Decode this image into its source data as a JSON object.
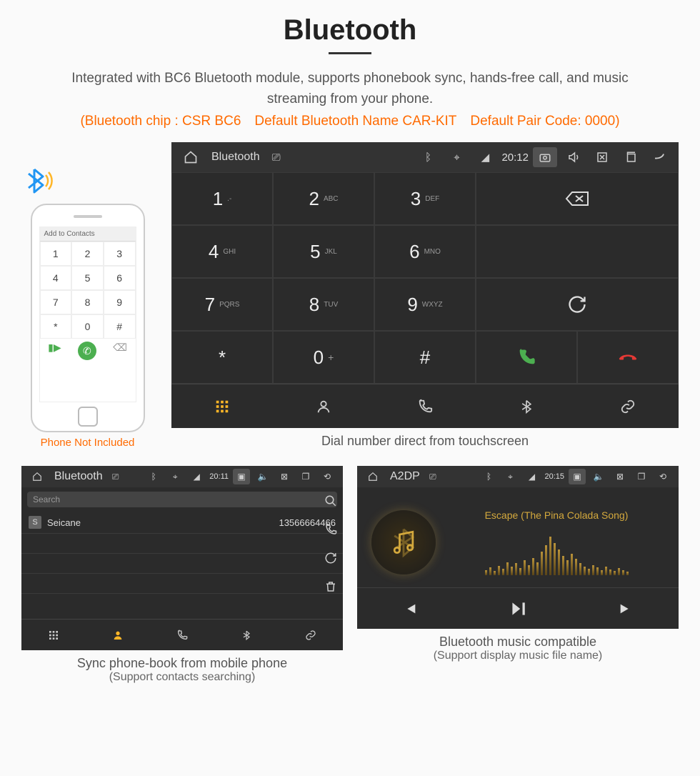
{
  "header": {
    "title": "Bluetooth",
    "description": "Integrated with BC6 Bluetooth module, supports phonebook sync, hands-free call, and music streaming from your phone.",
    "spec": "(Bluetooth chip : CSR BC6 Default Bluetooth Name CAR-KIT Default Pair Code: 0000)"
  },
  "phone": {
    "header": "Add to Contacts",
    "keys": [
      "1",
      "2",
      "3",
      "4",
      "5",
      "6",
      "7",
      "8",
      "9",
      "*",
      "0",
      "#"
    ],
    "caption": "Phone Not Included"
  },
  "dialer": {
    "statusbar": {
      "app": "Bluetooth",
      "time": "20:12"
    },
    "keys": [
      {
        "n": "1",
        "s": ".-"
      },
      {
        "n": "2",
        "s": "ABC"
      },
      {
        "n": "3",
        "s": "DEF"
      },
      {
        "n": "4",
        "s": "GHI"
      },
      {
        "n": "5",
        "s": "JKL"
      },
      {
        "n": "6",
        "s": "MNO"
      },
      {
        "n": "7",
        "s": "PQRS"
      },
      {
        "n": "8",
        "s": "TUV"
      },
      {
        "n": "9",
        "s": "WXYZ"
      },
      {
        "n": "*",
        "s": ""
      },
      {
        "n": "0",
        "s": "+"
      },
      {
        "n": "#",
        "s": ""
      }
    ],
    "caption": "Dial number direct from touchscreen"
  },
  "phonebook": {
    "statusbar": {
      "app": "Bluetooth",
      "time": "20:11"
    },
    "search_placeholder": "Search",
    "contact": {
      "badge": "S",
      "name": "Seicane",
      "number": "13566664466"
    },
    "caption_line1": "Sync phone-book from mobile phone",
    "caption_line2": "(Support contacts searching)"
  },
  "music": {
    "statusbar": {
      "app": "A2DP",
      "time": "20:15"
    },
    "track": "Escape (The Pina Colada Song)",
    "caption_line1": "Bluetooth music compatible",
    "caption_line2": "(Support display music file name)"
  }
}
